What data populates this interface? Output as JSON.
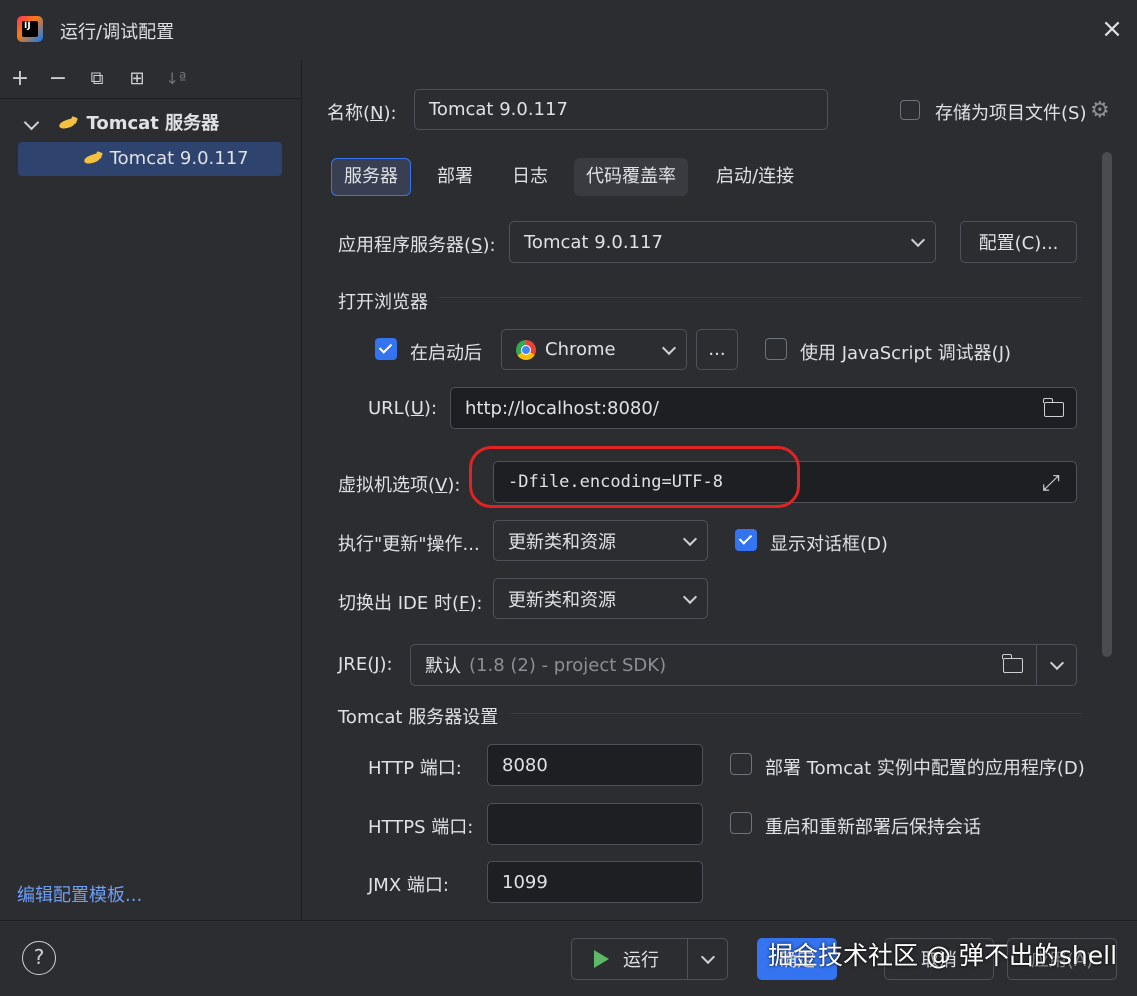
{
  "window": {
    "title": "运行/调试配置",
    "close_icon": "×"
  },
  "colors": {
    "accent": "#3574f0",
    "highlight": "#e02424",
    "link": "#6e9ef5"
  },
  "toolbar": {
    "add": "+",
    "remove": "−",
    "copy": "⧉",
    "folder": "⊞",
    "sort": "↓ª"
  },
  "tree": {
    "group_label": "Tomcat 服务器",
    "child_label": "Tomcat 9.0.117"
  },
  "edit_templates": "编辑配置模板...",
  "name": {
    "label_pre": "名称(",
    "label_key": "N",
    "label_post": "):",
    "value": "Tomcat 9.0.117"
  },
  "store_as_file": {
    "label": "存储为项目文件(S)"
  },
  "tabs": [
    "服务器",
    "部署",
    "日志",
    "代码覆盖率",
    "启动/连接"
  ],
  "app_server": {
    "label_pre": "应用程序服务器(",
    "label_key": "S",
    "label_post": "):",
    "value": "Tomcat 9.0.117",
    "configure": "配置(C)..."
  },
  "open_browser": {
    "section": "打开浏览器",
    "after_launch": "在启动后",
    "browser": "Chrome",
    "more": "...",
    "js_debugger": "使用 JavaScript 调试器(J)",
    "url_label_pre": "URL(",
    "url_label_key": "U",
    "url_label_post": "):",
    "url": "http://localhost:8080/"
  },
  "vm_options": {
    "label_pre": "虚拟机选项(",
    "label_key": "V",
    "label_post": "):",
    "value": "-Dfile.encoding=UTF-8"
  },
  "on_update": {
    "label": "执行\"更新\"操作...",
    "value": "更新类和资源",
    "show_dialog": "显示对话框(D)"
  },
  "on_frame_deactivation": {
    "label_pre": "切换出 IDE 时(",
    "label_key": "F",
    "label_post": "):",
    "value": "更新类和资源"
  },
  "jre": {
    "label_pre": "JRE(",
    "label_key": "J",
    "label_post": "):",
    "value": "默认",
    "hint": "(1.8 (2) - project SDK)"
  },
  "tomcat_settings": {
    "section": "Tomcat 服务器设置",
    "http_label": "HTTP 端口:",
    "http_value": "8080",
    "https_label": "HTTPS 端口:",
    "https_value": "",
    "jmx_label": "JMX 端口:",
    "jmx_value": "1099",
    "deploy_configured": "部署 Tomcat 实例中配置的应用程序(D)",
    "preserve_sessions": "重启和重新部署后保持会话"
  },
  "footer": {
    "help": "?",
    "run": "运行",
    "ok": "确定",
    "cancel": "取消",
    "apply": "应用(A)",
    "watermark": "掘金技术社区 @ 弹不出的shell"
  }
}
